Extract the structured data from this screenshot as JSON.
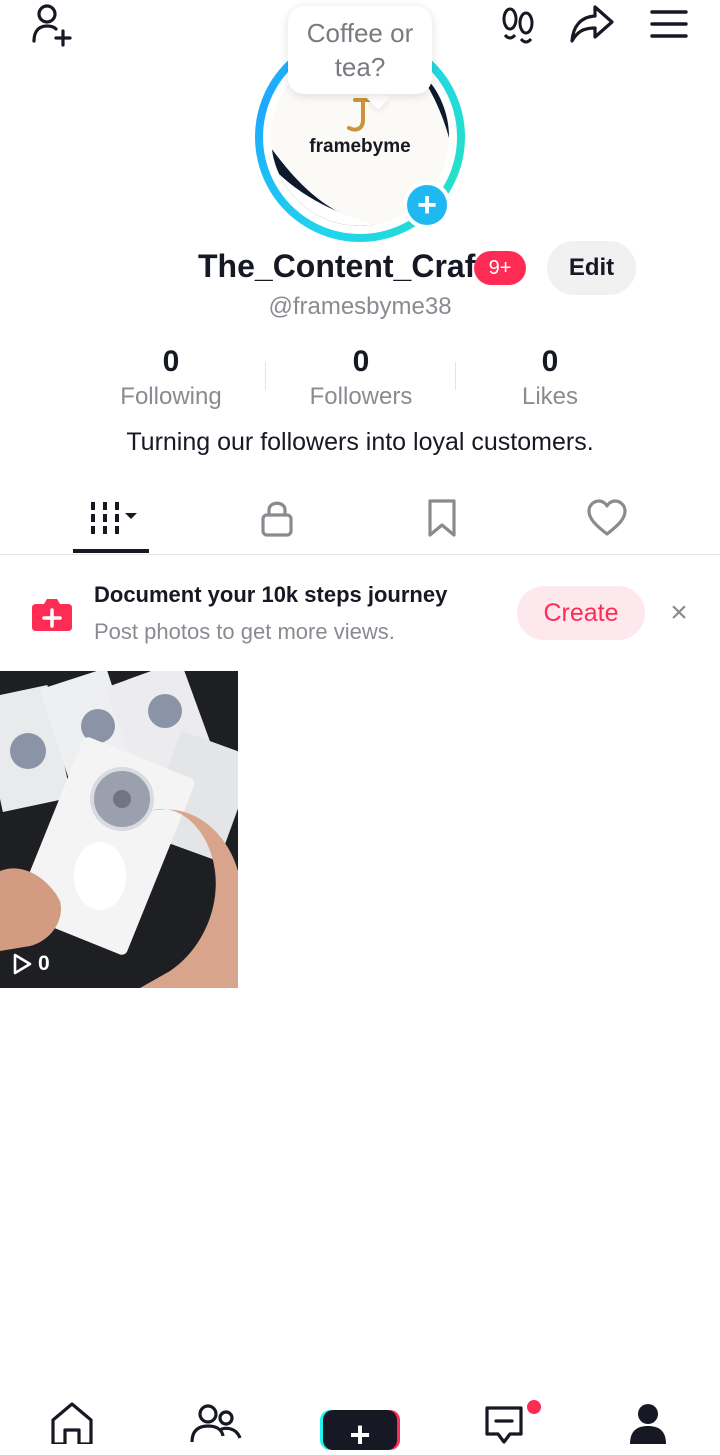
{
  "header": {
    "add_friend_icon": "person-plus-icon",
    "footprints_icon": "footprints-icon",
    "share_icon": "share-arrow-icon",
    "menu_icon": "hamburger-menu-icon"
  },
  "avatar": {
    "tooltip": "Coffee or tea?",
    "brand_text": "framebyme",
    "add_badge": "+"
  },
  "profile": {
    "username": "The_Content_Craft",
    "notification_badge": "9+",
    "edit_label": "Edit",
    "handle": "@framesbyme38",
    "bio": "Turning our followers into loyal customers."
  },
  "stats": [
    {
      "value": "0",
      "label": "Following"
    },
    {
      "value": "0",
      "label": "Followers"
    },
    {
      "value": "0",
      "label": "Likes"
    }
  ],
  "tabs": [
    {
      "icon": "videos-grid-icon",
      "selected": true
    },
    {
      "icon": "lock-icon"
    },
    {
      "icon": "bookmark-icon"
    },
    {
      "icon": "heart-icon"
    }
  ],
  "banner": {
    "title": "Document your 10k steps journey",
    "subtitle": "Post photos to get more views.",
    "create_label": "Create",
    "close_label": "×"
  },
  "videos": [
    {
      "views": "0"
    }
  ],
  "bottom_nav": [
    {
      "icon": "home-icon"
    },
    {
      "icon": "friends-icon"
    },
    {
      "icon": "create-plus-icon",
      "label": "+"
    },
    {
      "icon": "inbox-icon",
      "has_dot": true
    },
    {
      "icon": "profile-icon"
    }
  ],
  "colors": {
    "accent": "#fe2c55",
    "ring": "#20d5ec",
    "text": "#161823",
    "muted": "#8a8b91"
  }
}
